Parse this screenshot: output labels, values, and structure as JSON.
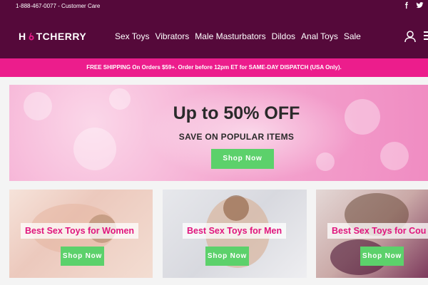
{
  "topbar": {
    "care_text": "1-888-467-0077 - Customer Care",
    "social_icons": [
      "facebook-icon",
      "twitter-icon"
    ]
  },
  "header": {
    "logo_left": "H",
    "logo_right": "TCHERRY",
    "nav": [
      "Sex Toys",
      "Vibrators",
      "Male Masturbators",
      "Dildos",
      "Anal Toys",
      "Sale"
    ],
    "account_icon": "user-icon",
    "menu_icon": "menu-icon"
  },
  "promo": {
    "text": "FREE SHIPPING On Orders $59+. Order before 12pm ET for SAME-DAY DISPATCH (USA Only)."
  },
  "hero": {
    "title": "Up to 50% OFF",
    "subtitle": "SAVE ON POPULAR ITEMS",
    "button": "Shop Now"
  },
  "cards": [
    {
      "label": "Best Sex Toys for Women",
      "button": "Shop Now"
    },
    {
      "label": "Best Sex Toys for Men",
      "button": "Shop Now"
    },
    {
      "label": "Best Sex Toys for Cou",
      "button": "Shop Now"
    }
  ],
  "colors": {
    "brand": "#55093a",
    "promo": "#ec1d8c",
    "accent_text": "#e0157d",
    "button": "#5cd16b"
  }
}
